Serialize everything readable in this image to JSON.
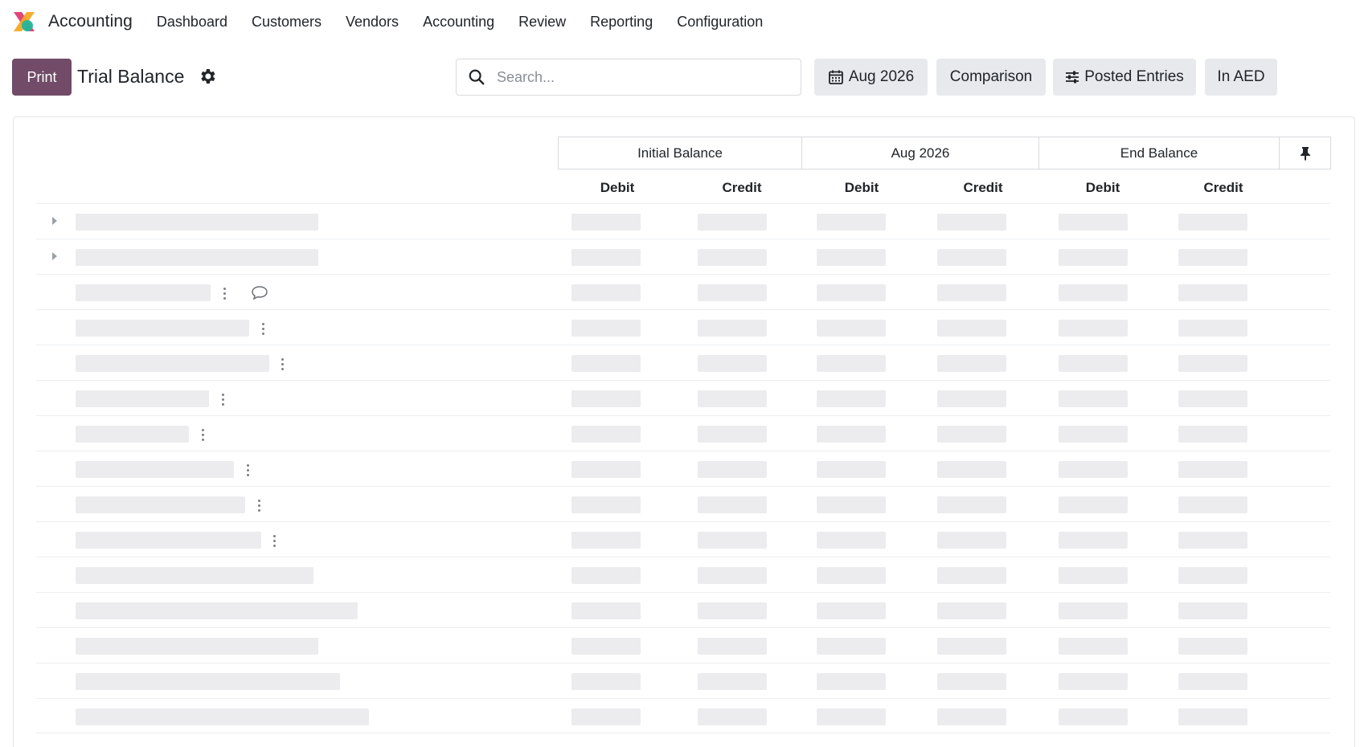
{
  "app": {
    "title": "Accounting",
    "logo_icon": "odoo-accounting-logo-icon",
    "brand_color": "#714b67"
  },
  "nav": {
    "items": [
      "Dashboard",
      "Customers",
      "Vendors",
      "Accounting",
      "Review",
      "Reporting",
      "Configuration"
    ]
  },
  "controls": {
    "print_label": "Print",
    "page_title": "Trial Balance",
    "settings_icon": "gear-icon",
    "search_placeholder": "Search...",
    "date_label": "Aug 2026",
    "comparison_label": "Comparison",
    "posted_label": "Posted Entries",
    "currency_label": "In AED"
  },
  "report": {
    "groups": [
      "Initial Balance",
      "Aug 2026",
      "End Balance"
    ],
    "pin_icon": "pin-icon",
    "columns": [
      "Debit",
      "Credit",
      "Debit",
      "Credit",
      "Debit",
      "Credit"
    ],
    "rows_loading": true
  }
}
